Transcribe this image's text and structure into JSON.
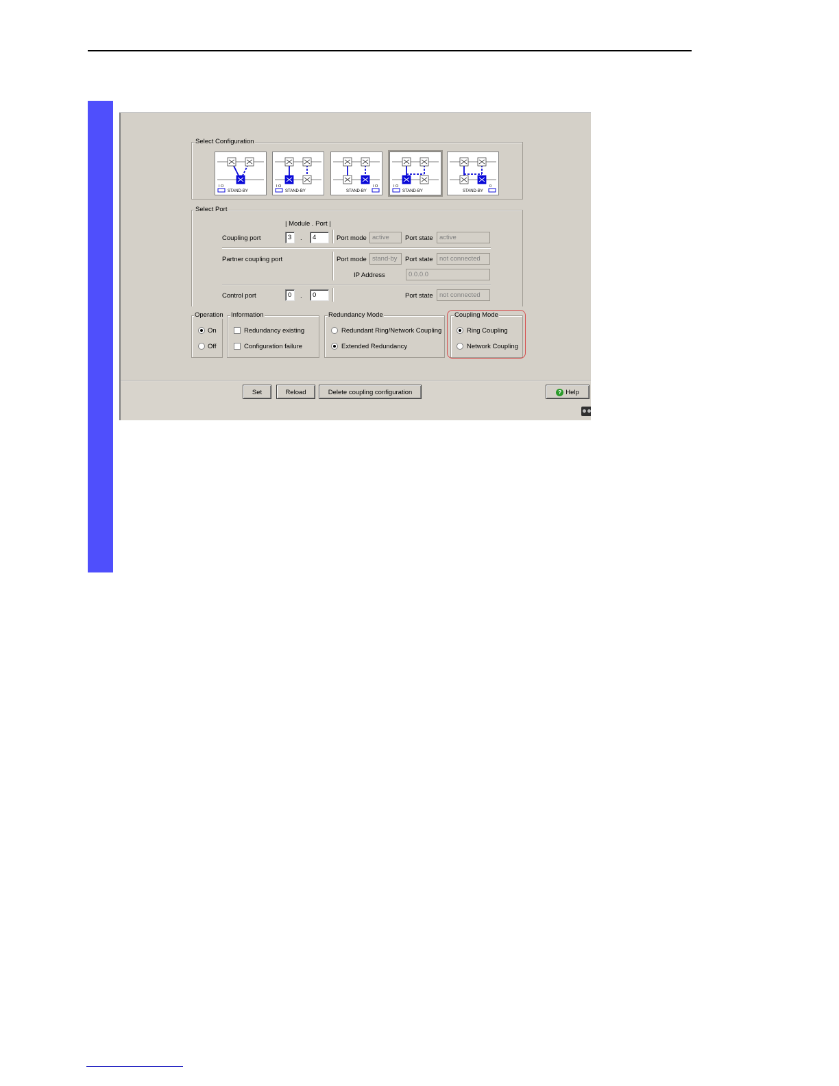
{
  "select_configuration": {
    "title": "Select Configuration",
    "options": [
      {
        "label": "STAND-BY",
        "indicator": "I O"
      },
      {
        "label": "STAND-BY",
        "indicator": "I O"
      },
      {
        "label": "STAND-BY",
        "indicator": "I O"
      },
      {
        "label": "STAND-BY",
        "indicator": "I O"
      },
      {
        "label": "STAND-BY",
        "indicator": "0"
      }
    ],
    "selected_index": 3
  },
  "select_port": {
    "title": "Select Port",
    "module_port_header": "| Module . Port |",
    "coupling_port": {
      "label": "Coupling port",
      "module": "3",
      "port": "4",
      "port_mode_label": "Port mode",
      "port_mode": "active",
      "port_state_label": "Port state",
      "port_state": "active"
    },
    "partner_coupling_port": {
      "label": "Partner coupling port",
      "port_mode_label": "Port mode",
      "port_mode": "stand-by",
      "port_state_label": "Port state",
      "port_state": "not connected",
      "ip_label": "IP Address",
      "ip": "0.0.0.0"
    },
    "control_port": {
      "label": "Control port",
      "module": "0",
      "port": "0",
      "port_state_label": "Port state",
      "port_state": "not connected"
    },
    "dot": "."
  },
  "operation": {
    "title": "Operation",
    "on": "On",
    "off": "Off",
    "selected": "On"
  },
  "information": {
    "title": "Information",
    "redundancy_existing": "Redundancy existing",
    "configuration_failure": "Configuration failure"
  },
  "redundancy_mode": {
    "title": "Redundancy Mode",
    "option1": "Redundant Ring/Network Coupling",
    "option2": "Extended Redundancy",
    "selected": "Extended Redundancy"
  },
  "coupling_mode": {
    "title": "Coupling Mode",
    "option1": "Ring Coupling",
    "option2": "Network Coupling",
    "selected": "Ring Coupling"
  },
  "buttons": {
    "set": "Set",
    "reload": "Reload",
    "delete": "Delete coupling configuration",
    "help": "Help"
  },
  "colors": {
    "side_bar": "#4f4ffc",
    "panel": "#d4d0c8",
    "highlight": "#d65050",
    "switch_active": "#0a0ad8"
  }
}
